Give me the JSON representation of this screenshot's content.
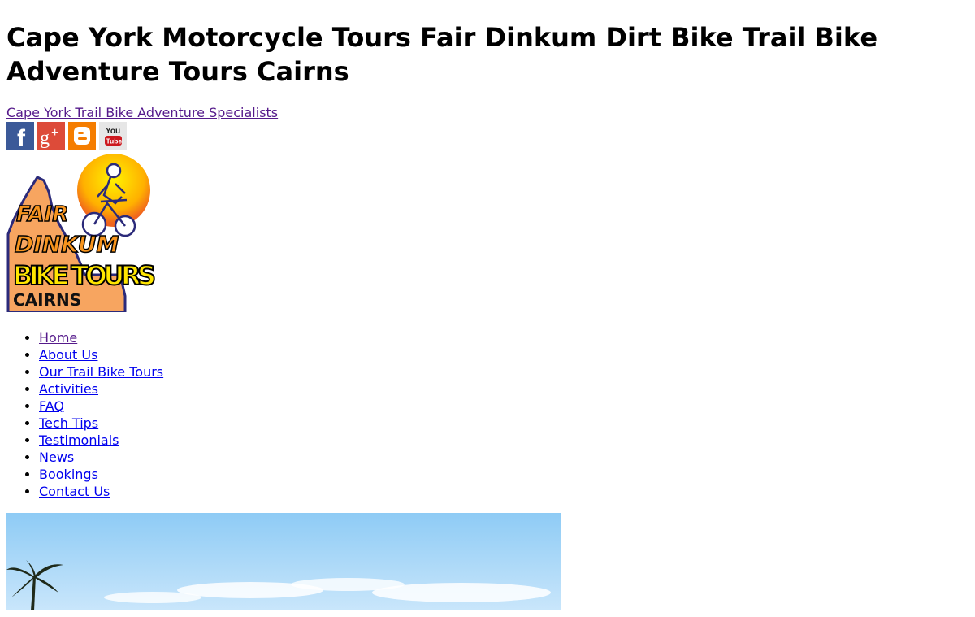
{
  "header": {
    "title": "Cape York Motorcycle Tours Fair Dinkum Dirt Bike Trail Bike Adventure Tours Cairns",
    "tagline": "Cape York Trail Bike Adventure Specialists"
  },
  "social": [
    {
      "name": "facebook-icon",
      "glyph": "f",
      "color": "#3b5998"
    },
    {
      "name": "google-plus-icon",
      "glyph": "g+",
      "color": "#dd4b39"
    },
    {
      "name": "blogger-icon",
      "glyph": "B",
      "color": "#f57d00"
    },
    {
      "name": "youtube-icon",
      "top": "You",
      "bottom": "Tube",
      "color": "#cc181e"
    }
  ],
  "logo": {
    "line1": "FAIR",
    "line2": "DINKUM",
    "line3": "BIKE TOURS",
    "line4": "CAIRNS"
  },
  "nav": {
    "items": [
      {
        "label": "Home"
      },
      {
        "label": "About Us"
      },
      {
        "label": "Our Trail Bike Tours"
      },
      {
        "label": "Activities"
      },
      {
        "label": "FAQ"
      },
      {
        "label": "Tech Tips"
      },
      {
        "label": "Testimonials"
      },
      {
        "label": "News"
      },
      {
        "label": "Bookings"
      },
      {
        "label": "Contact Us"
      }
    ]
  },
  "colors": {
    "link": "#0000ee",
    "visited": "#551a8b",
    "logo_orange": "#f7941d",
    "logo_yellow": "#ffe600",
    "logo_navy": "#2b2a7a"
  }
}
